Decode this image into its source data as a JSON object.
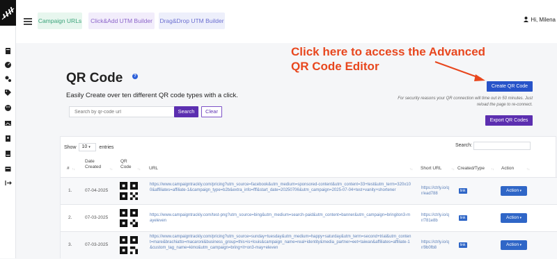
{
  "topbar": {
    "tabs": [
      {
        "label": "Campaign URLs",
        "bg": "#e7f6ee",
        "color": "#3aa37a"
      },
      {
        "label": "Click&Add UTM Builder",
        "bg": "#f2edfb",
        "color": "#8b63c9"
      },
      {
        "label": "Drag&Drop UTM Builder",
        "bg": "#edeffb",
        "color": "#6b6fd0"
      }
    ],
    "user_greeting": "Hi, Milena"
  },
  "sidebar": {
    "icons": [
      "book-icon",
      "gauge-icon",
      "gears-icon",
      "tags-icon",
      "palette-icon",
      "image-icon",
      "contact-icon",
      "globe-icon",
      "book-open-icon",
      "logout-icon"
    ]
  },
  "page": {
    "title": "QR Code",
    "subtitle": "Easily Create over ten different QR code types with a click.",
    "search_placeholder": "Search by qr-code url",
    "search_button": "Search",
    "clear_button": "Clear",
    "annotation_line1": "Click here to access the Advanced",
    "annotation_line2": "QR Code Editor",
    "create_button": "Create QR Code",
    "notice_line1": "For security reasons your QR connection will time out in 50 minutes. Just",
    "notice_line2": "reload the page to re-connect.",
    "export_button": "Export QR Codes"
  },
  "table": {
    "show_label": "Show",
    "show_value": "10",
    "entries_label": "entries",
    "search_label": "Search:",
    "headers": [
      "#",
      "Date Created",
      "QR Code",
      "URL",
      "Short URL",
      "Created/Type",
      "Action"
    ],
    "rows": [
      {
        "index": "1.",
        "date": "07-04-2025",
        "url": "https://www.campaigntrackly.com/pricing?utm_source=facebook&utm_medium=sponsored-content&utm_content=33+test&utm_term=320x100&affiliates=affiliate-1&campaign_type=b2b&extra_info=fff&start_date=20250706&utm_campaign=2025-07-04+test+vanity+shortener",
        "short_url": "https://ctrly.io/qr/ead788",
        "type": "link",
        "action": "Action"
      },
      {
        "index": "2.",
        "date": "07-03-2025",
        "url": "https://www.campaigntrackly.com/test-png?utm_source=bing&utm_medium=search-paid&utm_content=banner&utm_campaign=bringiton3-mayeleven",
        "short_url": "https://ctrly.io/qr/781e8b",
        "type": "link",
        "action": "Action"
      },
      {
        "index": "3.",
        "date": "07-03-2025",
        "url": "https://www.campaigntrackly.com/pricing?utm_source=sunday+tuesday&utm_medium=happy+saturday&utm_term=second+trial&utm_content=mare&brachiatto=macaroni&business_group=this+is+louis&campaign_name=real+identity&media_partner=eet+taiwan&affiliates=affiliate-1&custom_tag_name=kimo&utm_campaign=bring+it+on3-may+eleven",
        "short_url": "https://ctrly.io/qr/9b0fb8",
        "type": "link",
        "action": "Action"
      }
    ]
  }
}
